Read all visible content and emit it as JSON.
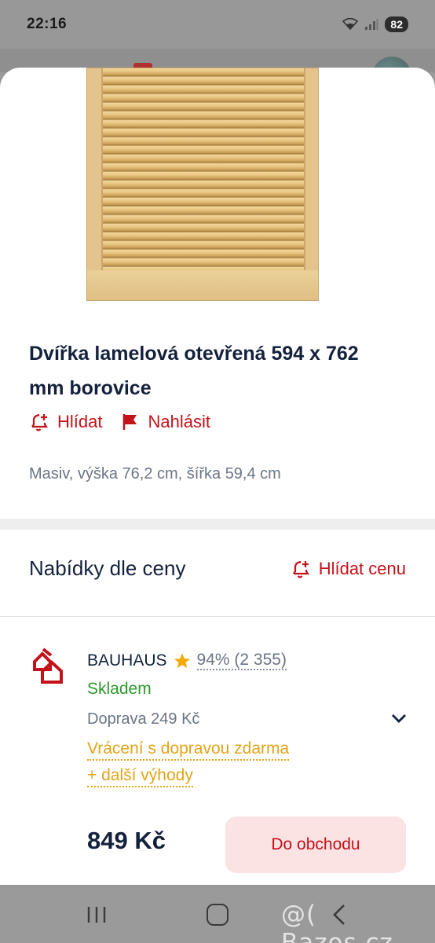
{
  "status_bar": {
    "time": "22:16",
    "battery": "82",
    "icons": [
      "wifi-icon",
      "signal-icon"
    ]
  },
  "product": {
    "image_icon": "louvered-door-image",
    "title": "Dvířka lamelová otevřená 594 x 762 mm borovice",
    "watch_label": "Hlídat",
    "report_label": "Nahlásit",
    "description": "Masiv, výška 76,2 cm, šířka 59,4 cm"
  },
  "offers": {
    "title": "Nabídky dle ceny",
    "watch_price_label": "Hlídat cenu",
    "items": [
      {
        "shop": "BAUHAUS",
        "rating": "94% (2 355)",
        "availability": "Skladem",
        "shipping": "Doprava 249 Kč",
        "perks": [
          "Vrácení s dopravou zdarma",
          "+ další výhody"
        ],
        "price": "849 Kč",
        "button_label": "Do obchodu"
      }
    ]
  },
  "colors": {
    "accent_red": "#c4121b",
    "stock_green": "#2b9a2b",
    "perk_yellow": "#e2a418",
    "title_navy": "#14213d",
    "star": "#f5a800"
  },
  "watermark": "@( Bazos.cz"
}
